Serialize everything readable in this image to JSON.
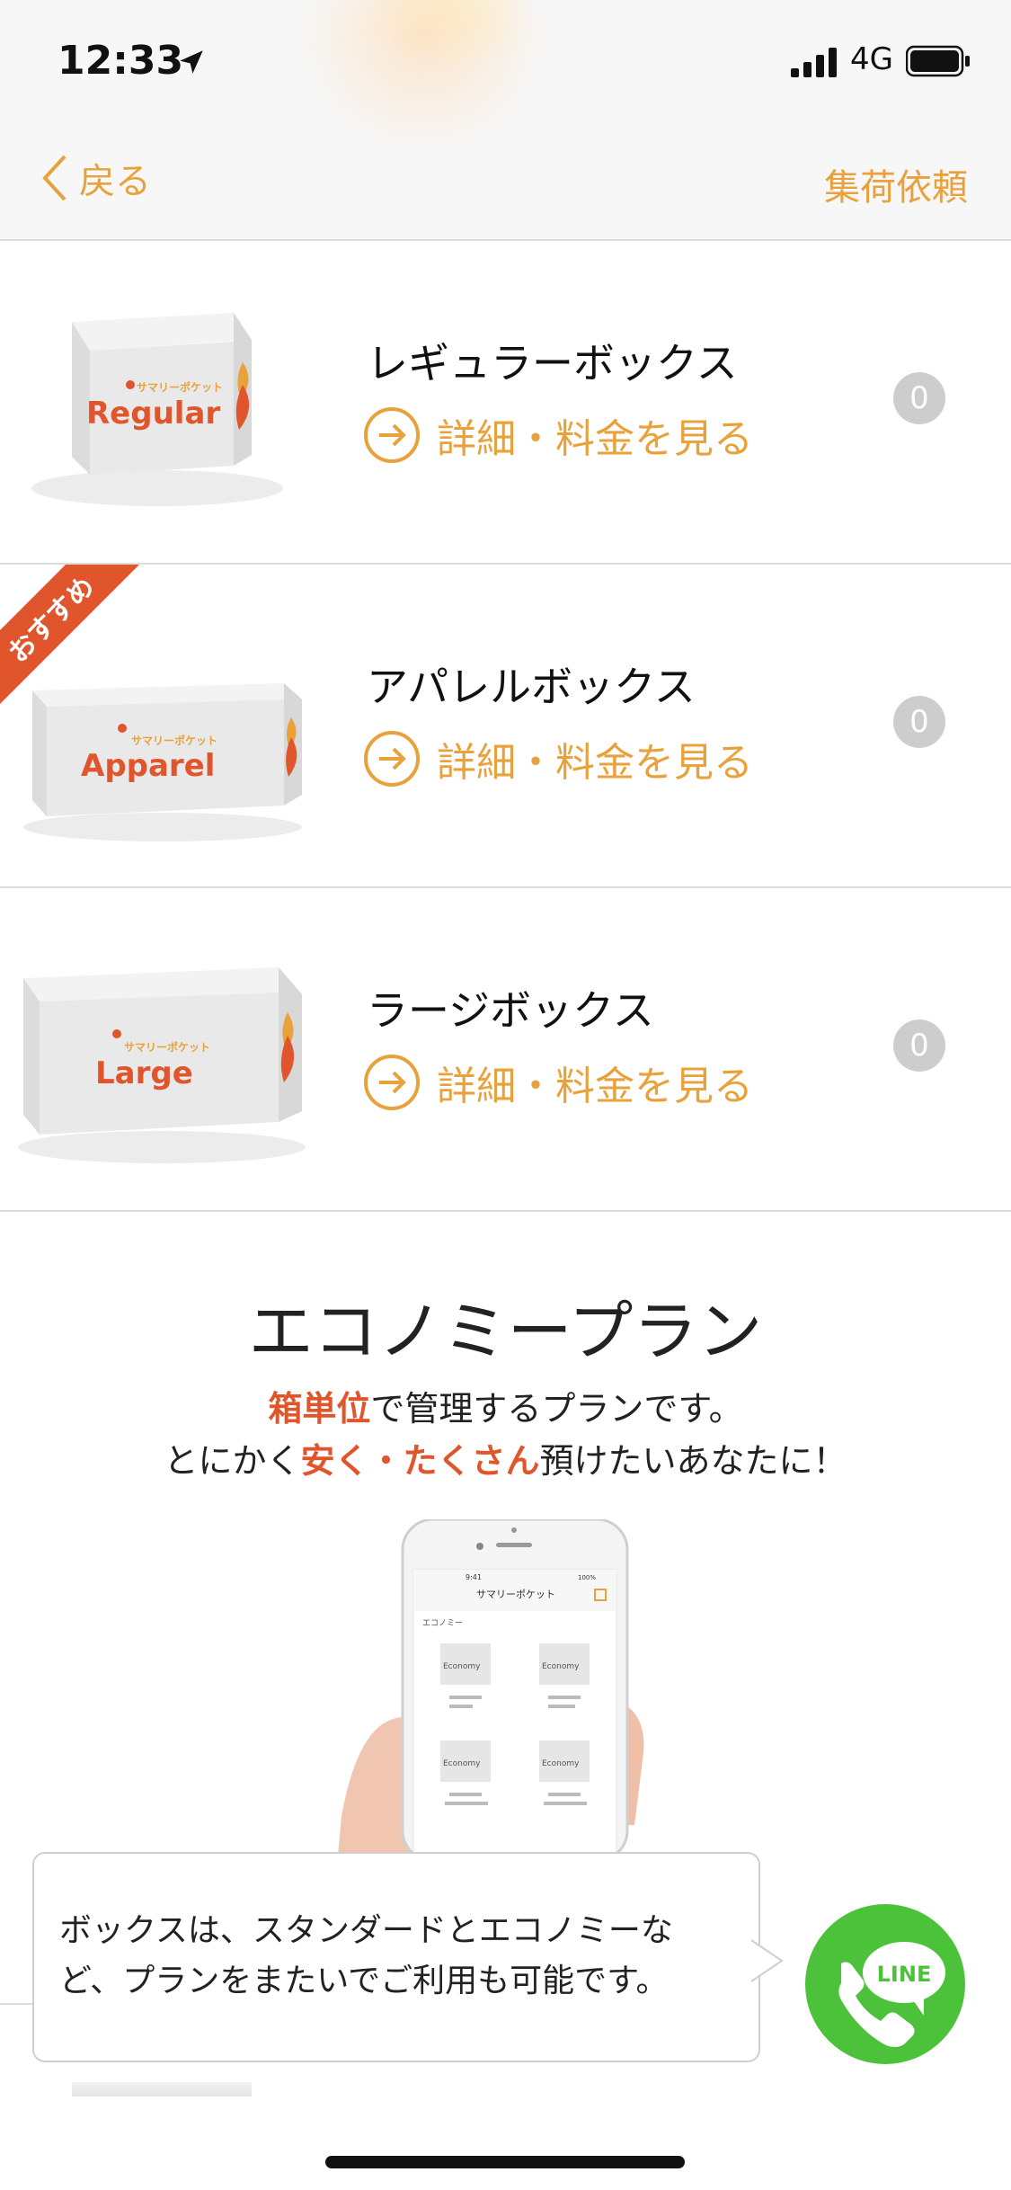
{
  "status_bar": {
    "time": "12:33",
    "network": "4G"
  },
  "nav": {
    "back_label": "戻る",
    "right_action": "集荷依頼"
  },
  "boxes": [
    {
      "name": "レギュラーボックス",
      "detail_link": "詳細・料金を見る",
      "count": "0",
      "box_label": "Regular",
      "brand": "サマリーポケット"
    },
    {
      "name": "アパレルボックス",
      "detail_link": "詳細・料金を見る",
      "count": "0",
      "box_label": "Apparel",
      "brand": "サマリーポケット",
      "ribbon": "おすすめ"
    },
    {
      "name": "ラージボックス",
      "detail_link": "詳細・料金を見る",
      "count": "0",
      "box_label": "Large",
      "brand": "サマリーポケット"
    }
  ],
  "economy": {
    "title": "エコノミープラン",
    "line1": {
      "accent": "箱単位",
      "rest": "で管理するプランです。"
    },
    "line2": {
      "pre": "とにかく",
      "accent": "安く・たくさん",
      "post": "預けたいあなたに！"
    },
    "phone_screen": {
      "header": "サマリーポケット",
      "section": "エコノミー",
      "box_label": "Economy",
      "time": "9:41",
      "battery": "100%"
    }
  },
  "tooltip": {
    "line1": "ボックスは、スタンダードとエコノミーな",
    "line2": "ど、プランをまたいでご利用も可能です。"
  },
  "line_button": {
    "label": "LINE"
  },
  "colors": {
    "accent": "#e8a13b",
    "highlight": "#e0552b",
    "line_green": "#4cc13a"
  }
}
